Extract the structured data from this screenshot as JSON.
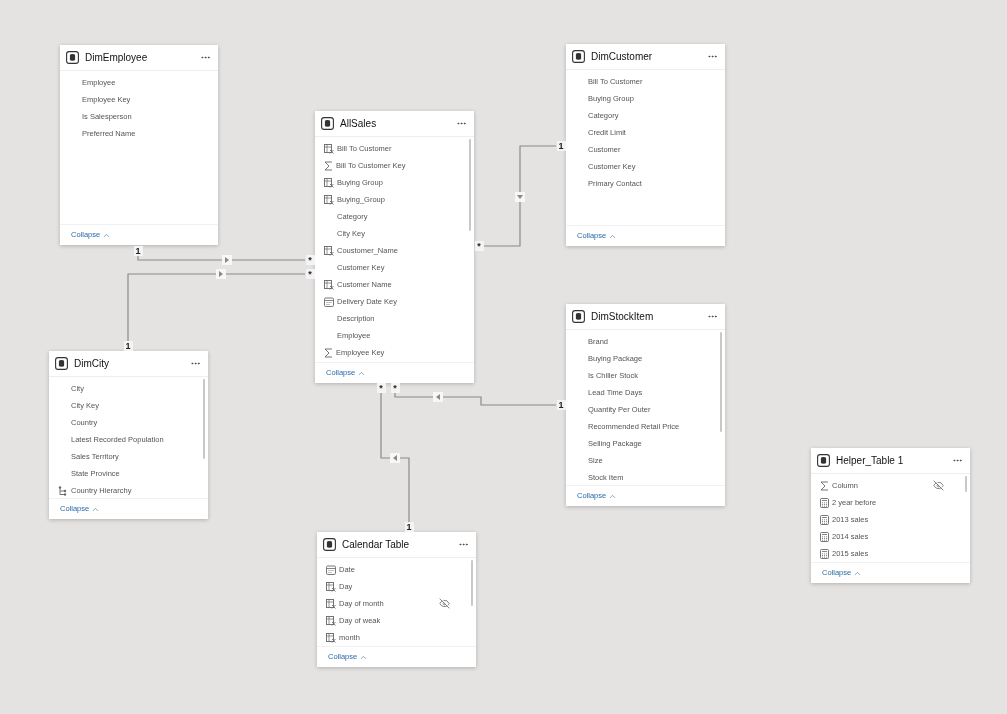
{
  "tables": [
    {
      "title": "DimEmployee",
      "scrollable": false,
      "collapse": "Collapse",
      "fields": [
        {
          "name": "Employee",
          "kind": "plain",
          "hidden": false
        },
        {
          "name": "Employee Key",
          "kind": "plain",
          "hidden": false
        },
        {
          "name": "Is Salesperson",
          "kind": "plain",
          "hidden": false
        },
        {
          "name": "Preferred Name",
          "kind": "plain",
          "hidden": false
        }
      ]
    },
    {
      "title": "AllSales",
      "scrollable": true,
      "collapse": "Collapse",
      "fields": [
        {
          "name": "Bill To Customer",
          "kind": "calc",
          "hidden": false
        },
        {
          "name": "Bill To Customer Key",
          "kind": "sum",
          "hidden": false
        },
        {
          "name": "Buying Group",
          "kind": "calc",
          "hidden": false
        },
        {
          "name": "Buying_Group",
          "kind": "calc",
          "hidden": false
        },
        {
          "name": "Category",
          "kind": "plain",
          "hidden": false
        },
        {
          "name": "City Key",
          "kind": "plain",
          "hidden": false
        },
        {
          "name": "Coustomer_Name",
          "kind": "calc",
          "hidden": false
        },
        {
          "name": "Customer Key",
          "kind": "plain",
          "hidden": false
        },
        {
          "name": "Customer Name",
          "kind": "calc",
          "hidden": false
        },
        {
          "name": "Delivery Date Key",
          "kind": "date",
          "hidden": false
        },
        {
          "name": "Description",
          "kind": "plain",
          "hidden": false
        },
        {
          "name": "Employee",
          "kind": "plain",
          "hidden": false
        },
        {
          "name": "Employee Key",
          "kind": "sum",
          "hidden": false
        }
      ]
    },
    {
      "title": "DimCustomer",
      "scrollable": false,
      "collapse": "Collapse",
      "fields": [
        {
          "name": "Bill To Customer",
          "kind": "plain",
          "hidden": false
        },
        {
          "name": "Buying Group",
          "kind": "plain",
          "hidden": false
        },
        {
          "name": "Category",
          "kind": "plain",
          "hidden": false
        },
        {
          "name": "Credit Limit",
          "kind": "plain",
          "hidden": false
        },
        {
          "name": "Customer",
          "kind": "plain",
          "hidden": false
        },
        {
          "name": "Customer Key",
          "kind": "plain",
          "hidden": false
        },
        {
          "name": "Primary Contact",
          "kind": "plain",
          "hidden": false
        }
      ]
    },
    {
      "title": "DimStockItem",
      "scrollable": true,
      "collapse": "Collapse",
      "fields": [
        {
          "name": "Brand",
          "kind": "plain",
          "hidden": false
        },
        {
          "name": "Buying Package",
          "kind": "plain",
          "hidden": false
        },
        {
          "name": "Is Chiller Stock",
          "kind": "plain",
          "hidden": false
        },
        {
          "name": "Lead Time Days",
          "kind": "plain",
          "hidden": false
        },
        {
          "name": "Quantity Per Outer",
          "kind": "plain",
          "hidden": false
        },
        {
          "name": "Recommended Retail Price",
          "kind": "plain",
          "hidden": false
        },
        {
          "name": "Selling Package",
          "kind": "plain",
          "hidden": false
        },
        {
          "name": "Size",
          "kind": "plain",
          "hidden": false
        },
        {
          "name": "Stock Item",
          "kind": "plain",
          "hidden": false
        }
      ]
    },
    {
      "title": "DimCity",
      "scrollable": true,
      "collapse": "Collapse",
      "fields": [
        {
          "name": "City",
          "kind": "plain",
          "hidden": false
        },
        {
          "name": "City Key",
          "kind": "plain",
          "hidden": false
        },
        {
          "name": "Country",
          "kind": "plain",
          "hidden": false
        },
        {
          "name": "Latest Recorded Population",
          "kind": "plain",
          "hidden": false
        },
        {
          "name": "Sales Territory",
          "kind": "plain",
          "hidden": false
        },
        {
          "name": "State Province",
          "kind": "plain",
          "hidden": false
        },
        {
          "name": "Country Hierarchy",
          "kind": "hierarchy",
          "hidden": false
        }
      ]
    },
    {
      "title": "Calendar Table",
      "scrollable": true,
      "collapse": "Collapse",
      "fields": [
        {
          "name": "Date",
          "kind": "date",
          "hidden": false
        },
        {
          "name": "Day",
          "kind": "calc",
          "hidden": false
        },
        {
          "name": "Day of month",
          "kind": "calc",
          "hidden": true
        },
        {
          "name": "Day of weak",
          "kind": "calc",
          "hidden": false
        },
        {
          "name": "month",
          "kind": "calc",
          "hidden": false
        }
      ]
    },
    {
      "title": "Helper_Table 1",
      "scrollable": true,
      "collapse": "Collapse",
      "fields": [
        {
          "name": "Column",
          "kind": "sum",
          "hidden": true
        },
        {
          "name": "2 year before",
          "kind": "measure",
          "hidden": false
        },
        {
          "name": "2013 sales",
          "kind": "measure",
          "hidden": false
        },
        {
          "name": "2014 sales",
          "kind": "measure",
          "hidden": false
        },
        {
          "name": "2015 sales",
          "kind": "measure",
          "hidden": false
        }
      ]
    }
  ],
  "relationships": [
    {
      "one": "1",
      "many": "*"
    },
    {
      "one": "1",
      "many": "*"
    },
    {
      "one": "1",
      "many": "*"
    },
    {
      "one": "1",
      "many": "*"
    },
    {
      "one": "1",
      "many": "*"
    }
  ]
}
